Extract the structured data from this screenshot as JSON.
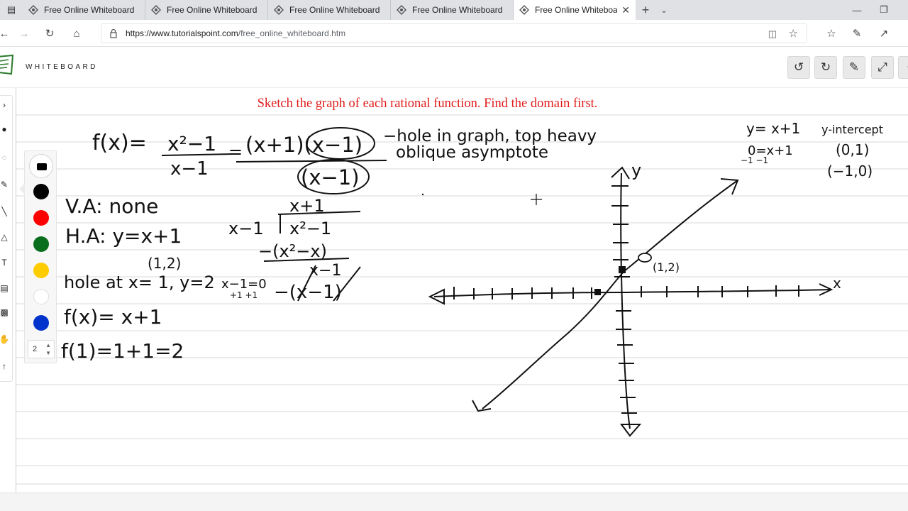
{
  "browser": {
    "tabs": [
      {
        "title": "Free Online Whiteboard",
        "active": false
      },
      {
        "title": "Free Online Whiteboard",
        "active": false
      },
      {
        "title": "Free Online Whiteboard",
        "active": false
      },
      {
        "title": "Free Online Whiteboard",
        "active": false
      },
      {
        "title": "Free Online Whiteboard",
        "active": true
      }
    ],
    "new_tab_glyph": "+",
    "tab_list_glyph": "⌄",
    "url_host": "https://www.tutorialspoint.com",
    "url_path": "/free_online_whiteboard.htm"
  },
  "app": {
    "brand": "WHITEBOARD",
    "header_buttons": [
      "undo-icon",
      "redo-icon",
      "brush-icon",
      "fullscreen-icon"
    ]
  },
  "board": {
    "heading": "Sketch the graph of each rational function. Find the domain first.",
    "heading_color": "#e01b1b",
    "palette": {
      "current_color": "#000000",
      "swatches": [
        "#000000",
        "#ff0000",
        "#0a6e1f",
        "#ffcc00",
        "#ffffff",
        "#0033cc"
      ],
      "brush_size": "2"
    },
    "handwriting": {
      "line1_f": "f(x)=",
      "numerator": "x²−1",
      "denominator": "x−1",
      "eq": "=",
      "factored": "(x+1)(x−1)",
      "factored_den": "(x−1)",
      "note1": "−hole in graph, top heavy",
      "note2": "oblique asymptote",
      "va": "V.A: none",
      "ha": "H.A: y=x+1",
      "hole_pt": "(1,2)",
      "hole": "hole at x= 1, y=2",
      "fx": "f(x)= x+1",
      "f1": "f(1)=1+1=2",
      "div_quot": "x+1",
      "div_divisor": "x−1",
      "div_dividend": "x²−1",
      "div_sub1": "−(x²−x)",
      "div_rem": "x−1",
      "div_sub2": "−(x−1)",
      "side1": "x−1=0",
      "side1b": "+1 +1",
      "yeq": "y= x+1",
      "zero": "0=x+1",
      "zero_b": "−1  −1",
      "yint": "y-intercept",
      "yint_pt": "(0,1)",
      "xint_pt": "(−1,0)",
      "axis_x": "x",
      "axis_y": "y",
      "graph_hole_label": "(1,2)"
    }
  }
}
